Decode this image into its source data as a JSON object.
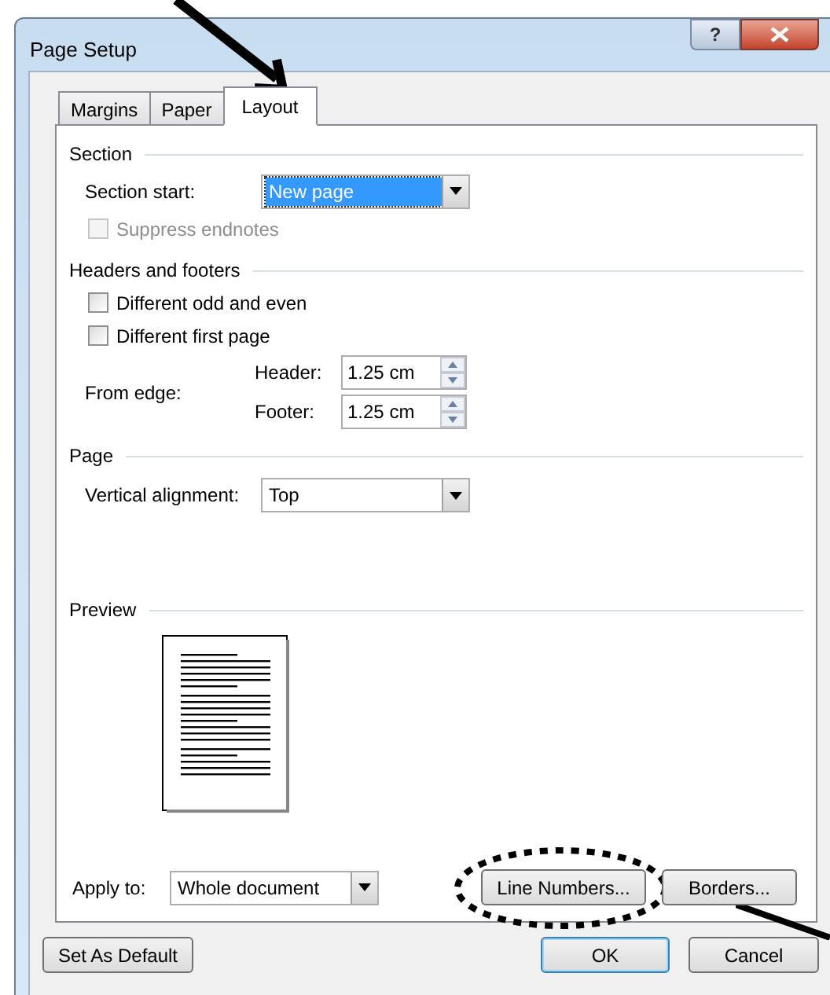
{
  "window": {
    "title": "Page Setup",
    "help_glyph": "?"
  },
  "tabs": [
    {
      "label": "Margins",
      "selected": false
    },
    {
      "label": "Paper",
      "selected": false
    },
    {
      "label": "Layout",
      "selected": true
    }
  ],
  "section": {
    "heading": "Section",
    "section_start": {
      "label": "Section start:",
      "value": "New page",
      "focused": true
    },
    "suppress_endnotes": {
      "label": "Suppress endnotes",
      "checked": false,
      "disabled": true
    }
  },
  "headers_footers": {
    "heading": "Headers and footers",
    "checkboxes": [
      {
        "label": "Different odd and even",
        "checked": false,
        "disabled": false
      },
      {
        "label": "Different first page",
        "checked": false,
        "disabled": false
      }
    ],
    "from_edge_label": "From edge:",
    "spinners": [
      {
        "label": "Header:",
        "value": "1.25 cm"
      },
      {
        "label": "Footer:",
        "value": "1.25 cm"
      }
    ]
  },
  "page": {
    "heading": "Page",
    "vertical_alignment": {
      "label": "Vertical alignment:",
      "value": "Top",
      "focused": false
    }
  },
  "preview": {
    "heading": "Preview"
  },
  "apply_to": {
    "label": "Apply to:",
    "value": "Whole document",
    "focused": false
  },
  "panel_buttons": [
    {
      "label": "Line Numbers...",
      "highlighted": true
    },
    {
      "label": "Borders...",
      "highlighted": false
    }
  ],
  "footer_buttons": [
    {
      "label": "Set As Default",
      "kind": "default-setter"
    },
    {
      "label": "OK",
      "kind": "primary"
    },
    {
      "label": "Cancel",
      "kind": "normal"
    }
  ]
}
